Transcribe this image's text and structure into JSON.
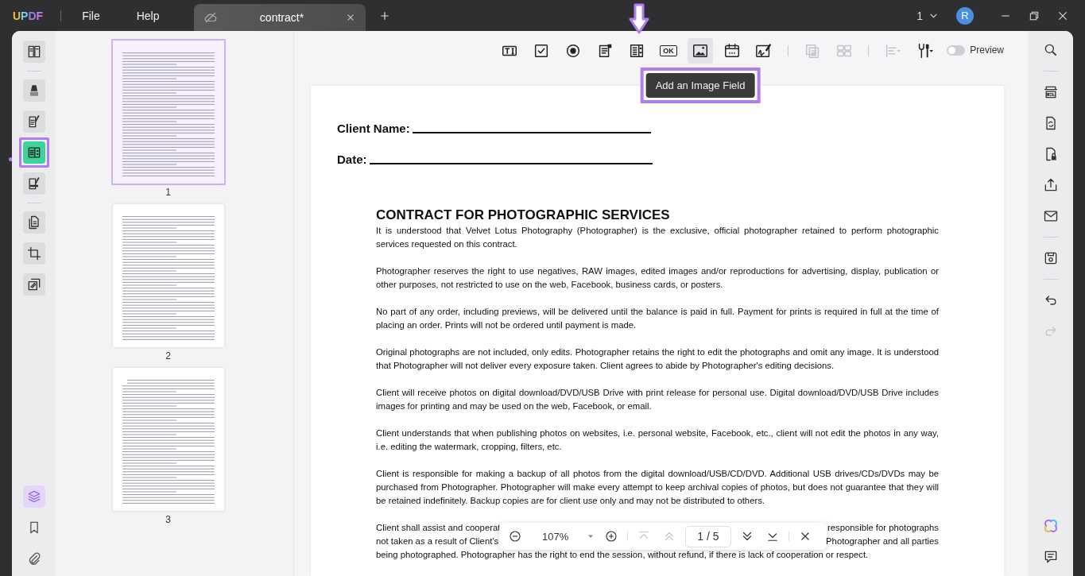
{
  "titlebar": {
    "logo": "UPDF",
    "menu": [
      "File",
      "Help"
    ],
    "tabs": [
      {
        "title": "contract*",
        "selected": true
      }
    ],
    "page_counter": "1",
    "avatar": "R"
  },
  "left_rail": {
    "groups": [
      [
        {
          "kind": "reader",
          "selected": false
        }
      ],
      [
        {
          "kind": "comment",
          "selected": false
        },
        {
          "kind": "edit",
          "selected": false
        },
        {
          "kind": "form",
          "selected": true
        },
        {
          "kind": "sign",
          "selected": false
        }
      ],
      [
        {
          "kind": "pages",
          "selected": false
        },
        {
          "kind": "crop",
          "selected": false
        },
        {
          "kind": "watermark",
          "selected": false
        }
      ]
    ],
    "bottom": [
      {
        "kind": "layers",
        "selected": true
      },
      {
        "kind": "bookmark",
        "selected": false
      },
      {
        "kind": "attachment",
        "selected": false
      }
    ]
  },
  "thumbnails": [
    {
      "page": "1",
      "selected": true
    },
    {
      "page": "2",
      "selected": false
    },
    {
      "page": "3",
      "selected": false
    }
  ],
  "toolbar": {
    "groups": [
      [
        {
          "kind": "text-field",
          "disabled": false,
          "hovered": false
        },
        {
          "kind": "checkbox",
          "disabled": false,
          "hovered": false
        },
        {
          "kind": "radio",
          "disabled": false,
          "hovered": false
        },
        {
          "kind": "combo-box",
          "disabled": false,
          "hovered": false
        },
        {
          "kind": "list-box",
          "disabled": false,
          "hovered": false
        },
        {
          "kind": "push-button",
          "label": "OK",
          "disabled": false,
          "hovered": false
        },
        {
          "kind": "image",
          "disabled": false,
          "hovered": true
        },
        {
          "kind": "date",
          "disabled": false,
          "hovered": false
        },
        {
          "kind": "signature",
          "disabled": false,
          "hovered": false
        }
      ],
      [
        {
          "kind": "duplicate",
          "disabled": true,
          "hovered": false
        },
        {
          "kind": "grid",
          "disabled": true,
          "hovered": false
        }
      ],
      [
        {
          "kind": "align",
          "disabled": true,
          "hovered": false
        },
        {
          "kind": "tools",
          "disabled": false,
          "hovered": false
        }
      ]
    ],
    "tooltip": "Add an Image Field",
    "preview": {
      "label": "Preview",
      "on": false
    }
  },
  "document": {
    "fields": [
      "Client Name:",
      "Date:"
    ],
    "title": "CONTRACT FOR PHOTOGRAPHIC SERVICES",
    "paragraphs": [
      "It is understood that Velvet Lotus Photography (Photographer) is the exclusive, official photographer retained to perform photographic services requested on this contract.",
      "Photographer reserves the right to use negatives, RAW images, edited images and/or reproductions for advertising, display, publication or other purposes, not restricted to use on the web, Facebook, business cards, or posters.",
      "No part of any order, including previews, will be delivered until the balance is paid in full. Payment for prints is required in full at the time of placing an order. Prints will not be ordered until payment is made.",
      "Original photographs are not included, only edits. Photographer retains the right to edit the photographs and omit any image. It is understood that Photographer will not deliver every exposure taken. Client agrees to abide by Photographer's editing decisions.",
      "Client will receive photos on digital download/DVD/USB Drive with print release for personal use. Digital download/DVD/USB Drive includes images for printing and may be used on the web, Facebook, or email.",
      "Client understands that when publishing photos on websites, i.e. personal website, Facebook, etc., client will not edit the photos in any way, i.e. editing the watermark, cropping, filters, etc.",
      "Client is responsible for making a backup of all photos from the digital download/USB/CD/DVD. Additional USB drives/CDs/DVDs may be purchased from Photographer. Photographer will make every attempt to keep archival copies of photos, but does not guarantee that they will be retained indefinitely. Backup copies are for client use only and may not be distributed to others."
    ],
    "last_paragraph": [
      {
        "left": "Client shall assist and cooperat",
        "right": "responsible for photographs"
      },
      {
        "left": "not taken as a result of Client’s",
        "right": "Photographer and all parties"
      },
      {
        "left": "being photographed. Photographer has the right to end the session, without refund, if there is lack of cooperation or respect."
      }
    ]
  },
  "zoom_bar": {
    "zoom": "107%",
    "page": "1 / 5",
    "nav": [
      {
        "kind": "first",
        "disabled": true
      },
      {
        "kind": "prev",
        "disabled": true
      },
      {
        "kind": "next",
        "disabled": false
      },
      {
        "kind": "last",
        "disabled": false
      }
    ]
  },
  "right_rail": {
    "groups": [
      [
        {
          "kind": "search",
          "disabled": false
        }
      ],
      [
        {
          "kind": "ocr",
          "disabled": false
        },
        {
          "kind": "convert",
          "disabled": false
        },
        {
          "kind": "protect",
          "disabled": false
        },
        {
          "kind": "share",
          "disabled": false
        },
        {
          "kind": "email",
          "disabled": false
        }
      ],
      [
        {
          "kind": "save",
          "disabled": false
        }
      ],
      [
        {
          "kind": "undo",
          "disabled": false
        },
        {
          "kind": "redo",
          "disabled": true
        }
      ]
    ],
    "bottom": [
      {
        "kind": "ai"
      },
      {
        "kind": "chat"
      }
    ]
  }
}
